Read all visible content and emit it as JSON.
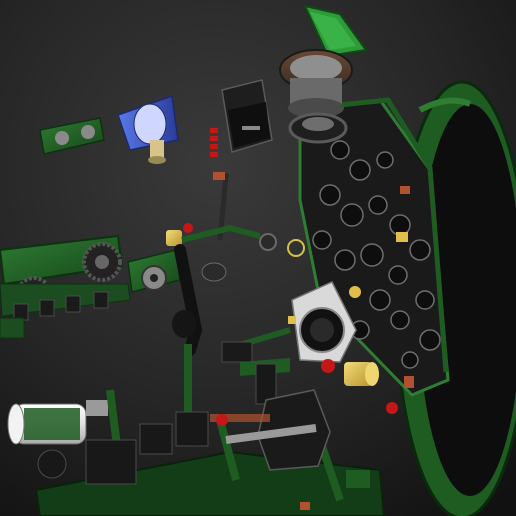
{
  "scene": {
    "kind": "cad-render-exploded-assembly",
    "background_colors": [
      "#3a3a3a",
      "#262626",
      "#111111"
    ],
    "palette": {
      "part_green": "#1f5c22",
      "part_green_light": "#2f7d33",
      "part_dark": "#1b1b1b",
      "metal": "#8a8a8a",
      "accent_red": "#c41818",
      "accent_yellow": "#e0c04a",
      "accent_blue": "#3a58c8",
      "bracket_brown": "#b0522f",
      "cylinder_white": "#e8e8e8"
    },
    "objects": [
      {
        "name": "round-cover-plate"
      },
      {
        "name": "instrument-panel"
      },
      {
        "name": "hatch-lid"
      },
      {
        "name": "electronics-box"
      },
      {
        "name": "pulley-block"
      },
      {
        "name": "left-gear-bracket"
      },
      {
        "name": "control-lever"
      },
      {
        "name": "white-cylinder"
      },
      {
        "name": "dial-mount"
      },
      {
        "name": "yellow-knob"
      },
      {
        "name": "seat-frame"
      }
    ]
  }
}
